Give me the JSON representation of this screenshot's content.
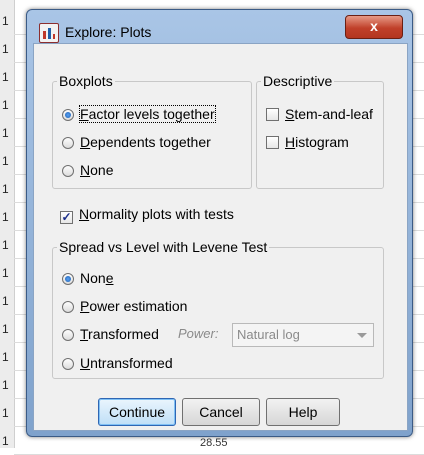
{
  "background": {
    "row_numbers": [
      "1",
      "1",
      "1",
      "1",
      "1",
      "1",
      "1",
      "1",
      "1",
      "1",
      "1",
      "1",
      "1",
      "1",
      "1",
      "1"
    ],
    "bottom_cell_value": "28.55"
  },
  "window": {
    "title": "Explore: Plots",
    "close_label": "x"
  },
  "boxplots": {
    "legend": "Boxplots",
    "options": [
      {
        "text": "Factor levels together",
        "underline": "F",
        "selected": true
      },
      {
        "text": "Dependents together",
        "underline": "D",
        "selected": false
      },
      {
        "text": "None",
        "underline": "N",
        "selected": false
      }
    ]
  },
  "descriptive": {
    "legend": "Descriptive",
    "options": [
      {
        "text": "Stem-and-leaf",
        "underline": "S",
        "checked": false
      },
      {
        "text": "Histogram",
        "underline": "H",
        "checked": false
      }
    ]
  },
  "normality": {
    "text": "Normality plots with tests",
    "underline": "N",
    "checked": true
  },
  "spread": {
    "legend": "Spread vs Level with Levene Test",
    "options": [
      {
        "text": "None",
        "underline": "e",
        "selected": true
      },
      {
        "text": "Power estimation",
        "underline": "P",
        "selected": false
      },
      {
        "text": "Transformed",
        "underline": "T",
        "selected": false
      },
      {
        "text": "Untransformed",
        "underline": "U",
        "selected": false
      }
    ],
    "power_label": "Power:",
    "power_value": "Natural log"
  },
  "buttons": {
    "continue": "Continue",
    "cancel": "Cancel",
    "help": "Help"
  }
}
